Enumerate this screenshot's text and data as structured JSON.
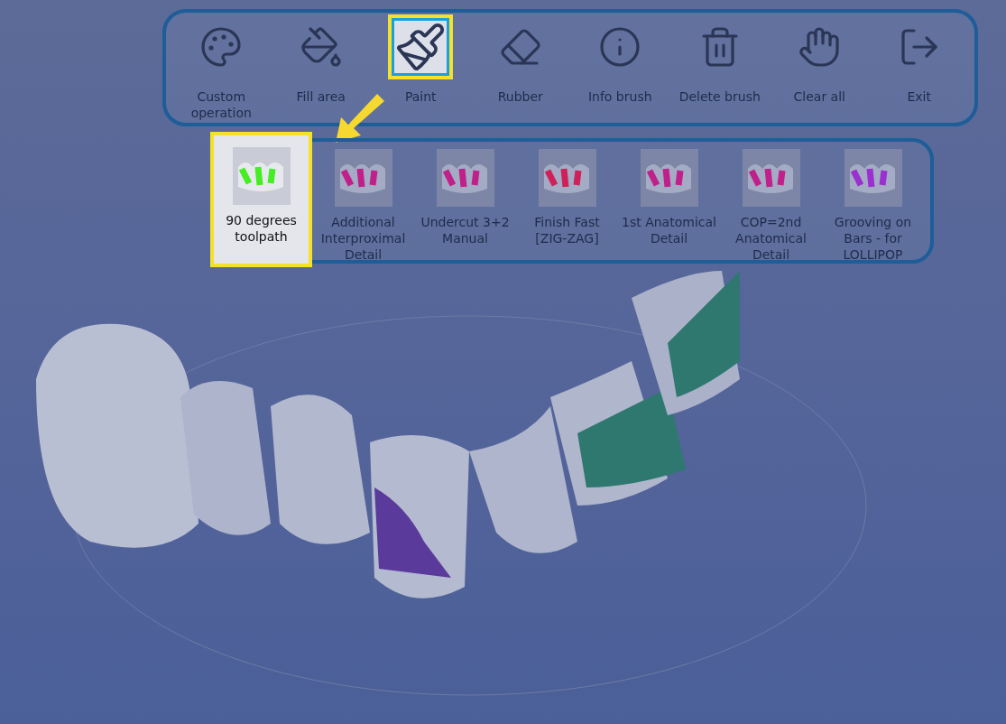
{
  "toolbar": {
    "tools": [
      {
        "label": "Custom operation",
        "selected": false
      },
      {
        "label": "Fill area",
        "selected": false
      },
      {
        "label": "Paint",
        "selected": true
      },
      {
        "label": "Rubber",
        "selected": false
      },
      {
        "label": "Info brush",
        "selected": false
      },
      {
        "label": "Delete brush",
        "selected": false
      },
      {
        "label": "Clear all",
        "selected": false
      },
      {
        "label": "Exit",
        "selected": false
      }
    ]
  },
  "brush_presets": [
    {
      "label": "90 degrees toolpath",
      "color": "#44ee22",
      "selected": true
    },
    {
      "label": "Additional Interproximal Detail",
      "color": "#c0208a",
      "selected": false
    },
    {
      "label": "Undercut 3+2 Manual",
      "color": "#c0208a",
      "selected": false
    },
    {
      "label": "Finish Fast [ZIG-ZAG]",
      "color": "#d0205a",
      "selected": false
    },
    {
      "label": "1st Anatomical Detail",
      "color": "#c0208a",
      "selected": false
    },
    {
      "label": "COP=2nd Anatomical Detail",
      "color": "#c0208a",
      "selected": false
    },
    {
      "label": "Grooving on Bars - for LOLLIPOP",
      "color": "#9a30d0",
      "selected": false
    }
  ]
}
